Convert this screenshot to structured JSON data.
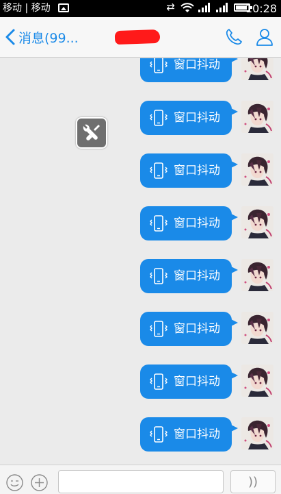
{
  "status_bar": {
    "carrier_text": "移动 | 移动",
    "time": "10:28",
    "icons": [
      "image-icon",
      "sync-icon",
      "wifi-icon",
      "signal-icon",
      "signal-icon",
      "battery-icon"
    ]
  },
  "nav": {
    "back_label": "消息(99...",
    "contact_name": "",
    "icons": [
      "chevron-left-icon",
      "phone-icon",
      "profile-icon"
    ]
  },
  "chat": {
    "messages": [
      {
        "text": "窗口抖动",
        "icon": "phone-shake-icon"
      },
      {
        "text": "窗口抖动",
        "icon": "phone-shake-icon"
      },
      {
        "text": "窗口抖动",
        "icon": "phone-shake-icon"
      },
      {
        "text": "窗口抖动",
        "icon": "phone-shake-icon"
      },
      {
        "text": "窗口抖动",
        "icon": "phone-shake-icon"
      },
      {
        "text": "窗口抖动",
        "icon": "phone-shake-icon"
      },
      {
        "text": "窗口抖动",
        "icon": "phone-shake-icon"
      },
      {
        "text": "窗口抖动",
        "icon": "phone-shake-icon"
      }
    ],
    "floating_tool_icon": "wrench-icon"
  },
  "input_bar": {
    "text_value": "",
    "placeholder": "",
    "voice_label": "))",
    "icons": [
      "emoji-icon",
      "plus-icon"
    ]
  },
  "colors": {
    "accent": "#1a8ae8",
    "redaction": "#ff1a1a",
    "background": "#ebebeb"
  }
}
